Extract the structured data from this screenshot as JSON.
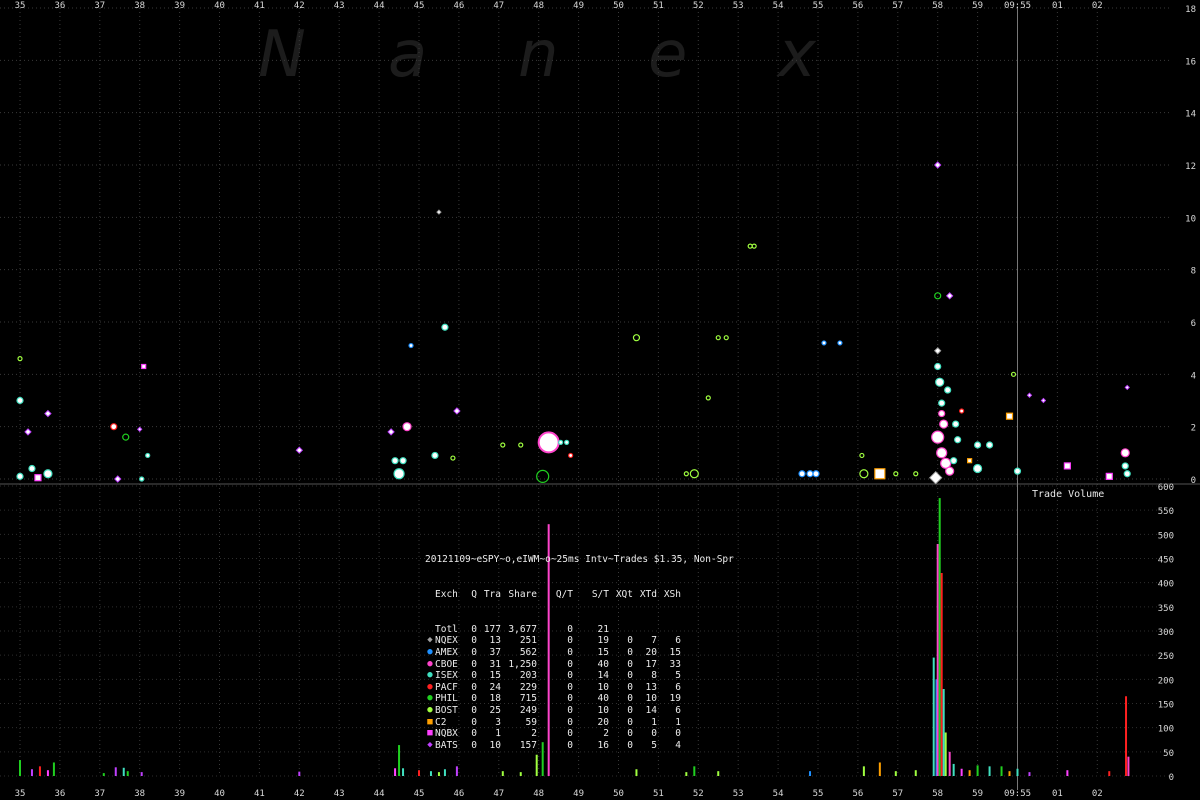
{
  "chart_data": {
    "type": "scatter",
    "watermark": [
      "N",
      "a",
      "n",
      "e",
      "x"
    ],
    "x_ticks": [
      "35",
      "36",
      "37",
      "38",
      "39",
      "40",
      "41",
      "42",
      "43",
      "44",
      "45",
      "46",
      "47",
      "48",
      "49",
      "50",
      "51",
      "52",
      "53",
      "54",
      "55",
      "56",
      "57",
      "58",
      "59",
      "09:55",
      "01",
      "02"
    ],
    "price_axis": {
      "ylim": [
        0,
        18
      ],
      "ticks": [
        "0",
        "2",
        "4",
        "6",
        "8",
        "10",
        "12",
        "14",
        "16",
        "18"
      ],
      "grid": true
    },
    "volume_axis": {
      "label": "Trade Volume",
      "ylim": [
        0,
        600
      ],
      "ticks": [
        "0",
        "50",
        "100",
        "150",
        "200",
        "250",
        "300",
        "350",
        "400",
        "450",
        "500",
        "550",
        "600"
      ]
    },
    "exchange_colors": {
      "NQEX": "#a0a0a0",
      "AMEX": "#1e90ff",
      "CBOE": "#ff44cc",
      "ISEX": "#40e0c0",
      "PACF": "#ff2020",
      "PHIL": "#20d020",
      "BOST": "#a0ff40",
      "C2": "#ffa000",
      "NQBX": "#ff40ff",
      "BATS": "#c040ff"
    },
    "trades": [
      {
        "x": 35.0,
        "y": 4.6,
        "ex": "BOST",
        "s": 2
      },
      {
        "x": 35.0,
        "y": 3.0,
        "ex": "ISEX",
        "s": 3
      },
      {
        "x": 35.2,
        "y": 1.8,
        "ex": "BATS",
        "s": 3
      },
      {
        "x": 35.0,
        "y": 0.1,
        "ex": "ISEX",
        "s": 3
      },
      {
        "x": 35.3,
        "y": 0.4,
        "ex": "ISEX",
        "s": 3
      },
      {
        "x": 35.45,
        "y": 0.05,
        "ex": "NQBX",
        "s": 3
      },
      {
        "x": 35.7,
        "y": 0.2,
        "ex": "ISEX",
        "s": 4
      },
      {
        "x": 35.7,
        "y": 2.5,
        "ex": "BATS",
        "s": 3
      },
      {
        "x": 37.35,
        "y": 2.0,
        "ex": "PACF",
        "s": 3
      },
      {
        "x": 37.65,
        "y": 1.6,
        "ex": "PHIL",
        "s": 3
      },
      {
        "x": 37.45,
        "y": 0.0,
        "ex": "BATS",
        "s": 3
      },
      {
        "x": 38.0,
        "y": 1.9,
        "ex": "BATS",
        "s": 2
      },
      {
        "x": 38.1,
        "y": 4.3,
        "ex": "NQBX",
        "s": 2
      },
      {
        "x": 38.2,
        "y": 0.9,
        "ex": "ISEX",
        "s": 2
      },
      {
        "x": 38.05,
        "y": 0.0,
        "ex": "ISEX",
        "s": 2
      },
      {
        "x": 42.0,
        "y": 1.1,
        "ex": "BATS",
        "s": 3
      },
      {
        "x": 44.3,
        "y": 1.8,
        "ex": "BATS",
        "s": 3
      },
      {
        "x": 44.5,
        "y": 0.2,
        "ex": "ISEX",
        "s": 5
      },
      {
        "x": 44.4,
        "y": 0.7,
        "ex": "ISEX",
        "s": 3
      },
      {
        "x": 44.6,
        "y": 0.7,
        "ex": "ISEX",
        "s": 3
      },
      {
        "x": 44.7,
        "y": 2.0,
        "ex": "CBOE",
        "s": 4
      },
      {
        "x": 44.8,
        "y": 5.1,
        "ex": "AMEX",
        "s": 2
      },
      {
        "x": 45.4,
        "y": 0.9,
        "ex": "ISEX",
        "s": 3
      },
      {
        "x": 45.5,
        "y": 10.2,
        "ex": "NQEX",
        "s": 2
      },
      {
        "x": 45.65,
        "y": 5.8,
        "ex": "ISEX",
        "s": 3
      },
      {
        "x": 45.85,
        "y": 0.8,
        "ex": "BOST",
        "s": 2
      },
      {
        "x": 45.95,
        "y": 2.6,
        "ex": "BATS",
        "s": 3
      },
      {
        "x": 47.1,
        "y": 1.3,
        "ex": "BOST",
        "s": 2
      },
      {
        "x": 47.55,
        "y": 1.3,
        "ex": "BOST",
        "s": 2
      },
      {
        "x": 48.25,
        "y": 1.4,
        "ex": "CBOE",
        "s": 10
      },
      {
        "x": 48.55,
        "y": 1.4,
        "ex": "ISEX",
        "s": 2
      },
      {
        "x": 48.7,
        "y": 1.4,
        "ex": "ISEX",
        "s": 2
      },
      {
        "x": 48.8,
        "y": 0.9,
        "ex": "PACF",
        "s": 2
      },
      {
        "x": 48.1,
        "y": 0.1,
        "ex": "PHIL",
        "s": 6
      },
      {
        "x": 50.45,
        "y": 5.4,
        "ex": "BOST",
        "s": 3
      },
      {
        "x": 51.7,
        "y": 0.2,
        "ex": "BOST",
        "s": 2
      },
      {
        "x": 51.9,
        "y": 0.2,
        "ex": "BOST",
        "s": 4
      },
      {
        "x": 52.25,
        "y": 3.1,
        "ex": "BOST",
        "s": 2
      },
      {
        "x": 52.5,
        "y": 5.4,
        "ex": "BOST",
        "s": 2
      },
      {
        "x": 52.7,
        "y": 5.4,
        "ex": "BOST",
        "s": 2
      },
      {
        "x": 53.3,
        "y": 8.9,
        "ex": "BOST",
        "s": 2
      },
      {
        "x": 53.4,
        "y": 8.9,
        "ex": "BOST",
        "s": 2
      },
      {
        "x": 54.6,
        "y": 0.2,
        "ex": "AMEX",
        "s": 3
      },
      {
        "x": 54.8,
        "y": 0.2,
        "ex": "AMEX",
        "s": 3
      },
      {
        "x": 54.95,
        "y": 0.2,
        "ex": "AMEX",
        "s": 3
      },
      {
        "x": 55.15,
        "y": 5.2,
        "ex": "AMEX",
        "s": 2
      },
      {
        "x": 55.55,
        "y": 5.2,
        "ex": "AMEX",
        "s": 2
      },
      {
        "x": 56.1,
        "y": 0.9,
        "ex": "BOST",
        "s": 2
      },
      {
        "x": 56.15,
        "y": 0.2,
        "ex": "BOST",
        "s": 4
      },
      {
        "x": 56.55,
        "y": 0.2,
        "ex": "C2",
        "s": 5
      },
      {
        "x": 56.95,
        "y": 0.2,
        "ex": "BOST",
        "s": 2
      },
      {
        "x": 57.45,
        "y": 0.2,
        "ex": "BOST",
        "s": 2
      },
      {
        "x": 58.0,
        "y": 12.0,
        "ex": "BATS",
        "s": 3
      },
      {
        "x": 58.0,
        "y": 7.0,
        "ex": "PHIL",
        "s": 3
      },
      {
        "x": 58.3,
        "y": 7.0,
        "ex": "BATS",
        "s": 3
      },
      {
        "x": 58.0,
        "y": 4.9,
        "ex": "NQEX",
        "s": 3
      },
      {
        "x": 58.0,
        "y": 4.3,
        "ex": "ISEX",
        "s": 3
      },
      {
        "x": 58.05,
        "y": 3.7,
        "ex": "ISEX",
        "s": 4
      },
      {
        "x": 58.1,
        "y": 2.9,
        "ex": "ISEX",
        "s": 3
      },
      {
        "x": 58.1,
        "y": 2.5,
        "ex": "CBOE",
        "s": 3
      },
      {
        "x": 58.15,
        "y": 2.1,
        "ex": "CBOE",
        "s": 4
      },
      {
        "x": 58.0,
        "y": 1.6,
        "ex": "CBOE",
        "s": 6
      },
      {
        "x": 58.1,
        "y": 1.0,
        "ex": "CBOE",
        "s": 5
      },
      {
        "x": 58.2,
        "y": 0.6,
        "ex": "CBOE",
        "s": 5
      },
      {
        "x": 58.3,
        "y": 0.3,
        "ex": "CBOE",
        "s": 4
      },
      {
        "x": 57.95,
        "y": 0.05,
        "ex": "NQEX",
        "s": 6
      },
      {
        "x": 58.25,
        "y": 3.4,
        "ex": "ISEX",
        "s": 3
      },
      {
        "x": 58.45,
        "y": 2.1,
        "ex": "ISEX",
        "s": 3
      },
      {
        "x": 58.6,
        "y": 2.6,
        "ex": "PACF",
        "s": 2
      },
      {
        "x": 58.5,
        "y": 1.5,
        "ex": "ISEX",
        "s": 3
      },
      {
        "x": 58.4,
        "y": 0.7,
        "ex": "ISEX",
        "s": 3
      },
      {
        "x": 58.8,
        "y": 0.7,
        "ex": "C2",
        "s": 2
      },
      {
        "x": 59.0,
        "y": 1.3,
        "ex": "ISEX",
        "s": 3
      },
      {
        "x": 59.3,
        "y": 1.3,
        "ex": "ISEX",
        "s": 3
      },
      {
        "x": 59.0,
        "y": 0.4,
        "ex": "ISEX",
        "s": 4
      },
      {
        "x": 59.8,
        "y": 2.4,
        "ex": "C2",
        "s": 3
      },
      {
        "x": 59.9,
        "y": 4.0,
        "ex": "BOST",
        "s": 2
      },
      {
        "x": 60.0,
        "y": 0.3,
        "ex": "ISEX",
        "s": 3
      },
      {
        "x": 60.3,
        "y": 3.2,
        "ex": "BATS",
        "s": 2
      },
      {
        "x": 60.65,
        "y": 3.0,
        "ex": "BATS",
        "s": 2
      },
      {
        "x": 61.25,
        "y": 0.5,
        "ex": "NQBX",
        "s": 3
      },
      {
        "x": 62.3,
        "y": 0.1,
        "ex": "NQBX",
        "s": 3
      },
      {
        "x": 62.7,
        "y": 1.0,
        "ex": "CBOE",
        "s": 4
      },
      {
        "x": 62.7,
        "y": 0.5,
        "ex": "ISEX",
        "s": 3
      },
      {
        "x": 62.75,
        "y": 0.2,
        "ex": "ISEX",
        "s": 3
      },
      {
        "x": 62.75,
        "y": 3.5,
        "ex": "BATS",
        "s": 2
      }
    ],
    "volume_bars": [
      {
        "x": 35.0,
        "v": 33,
        "ex": "PHIL"
      },
      {
        "x": 35.3,
        "v": 14,
        "ex": "BATS"
      },
      {
        "x": 35.5,
        "v": 20,
        "ex": "PACF"
      },
      {
        "x": 35.7,
        "v": 12,
        "ex": "NQBX"
      },
      {
        "x": 35.85,
        "v": 28,
        "ex": "PHIL"
      },
      {
        "x": 37.1,
        "v": 6,
        "ex": "PHIL"
      },
      {
        "x": 37.4,
        "v": 18,
        "ex": "BATS"
      },
      {
        "x": 37.6,
        "v": 17,
        "ex": "ISEX"
      },
      {
        "x": 37.7,
        "v": 10,
        "ex": "PHIL"
      },
      {
        "x": 38.05,
        "v": 8,
        "ex": "BATS"
      },
      {
        "x": 42.0,
        "v": 9,
        "ex": "BATS"
      },
      {
        "x": 44.4,
        "v": 16,
        "ex": "NQBX"
      },
      {
        "x": 44.5,
        "v": 64,
        "ex": "PHIL"
      },
      {
        "x": 44.6,
        "v": 16,
        "ex": "ISEX"
      },
      {
        "x": 45.0,
        "v": 12,
        "ex": "PACF"
      },
      {
        "x": 45.3,
        "v": 10,
        "ex": "ISEX"
      },
      {
        "x": 45.5,
        "v": 8,
        "ex": "BOST"
      },
      {
        "x": 45.65,
        "v": 14,
        "ex": "ISEX"
      },
      {
        "x": 45.95,
        "v": 20,
        "ex": "BATS"
      },
      {
        "x": 47.1,
        "v": 10,
        "ex": "BOST"
      },
      {
        "x": 47.55,
        "v": 8,
        "ex": "BOST"
      },
      {
        "x": 47.95,
        "v": 44,
        "ex": "BOST"
      },
      {
        "x": 48.1,
        "v": 70,
        "ex": "PHIL"
      },
      {
        "x": 48.25,
        "v": 521,
        "ex": "CBOE"
      },
      {
        "x": 50.45,
        "v": 14,
        "ex": "BOST"
      },
      {
        "x": 51.7,
        "v": 8,
        "ex": "BOST"
      },
      {
        "x": 51.9,
        "v": 20,
        "ex": "PHIL"
      },
      {
        "x": 52.5,
        "v": 10,
        "ex": "BOST"
      },
      {
        "x": 54.8,
        "v": 10,
        "ex": "AMEX"
      },
      {
        "x": 56.15,
        "v": 20,
        "ex": "BOST"
      },
      {
        "x": 56.55,
        "v": 28,
        "ex": "C2"
      },
      {
        "x": 56.95,
        "v": 10,
        "ex": "BOST"
      },
      {
        "x": 57.45,
        "v": 12,
        "ex": "BOST"
      },
      {
        "x": 57.9,
        "v": 245,
        "ex": "ISEX"
      },
      {
        "x": 57.97,
        "v": 200,
        "ex": "AMEX"
      },
      {
        "x": 58.0,
        "v": 480,
        "ex": "CBOE"
      },
      {
        "x": 58.05,
        "v": 575,
        "ex": "PHIL"
      },
      {
        "x": 58.1,
        "v": 420,
        "ex": "PACF"
      },
      {
        "x": 58.15,
        "v": 180,
        "ex": "ISEX"
      },
      {
        "x": 58.2,
        "v": 90,
        "ex": "BOST"
      },
      {
        "x": 58.3,
        "v": 50,
        "ex": "CBOE"
      },
      {
        "x": 58.4,
        "v": 25,
        "ex": "ISEX"
      },
      {
        "x": 58.6,
        "v": 15,
        "ex": "NQBX"
      },
      {
        "x": 58.8,
        "v": 12,
        "ex": "C2"
      },
      {
        "x": 59.0,
        "v": 22,
        "ex": "PHIL"
      },
      {
        "x": 59.3,
        "v": 20,
        "ex": "ISEX"
      },
      {
        "x": 59.6,
        "v": 20,
        "ex": "PHIL"
      },
      {
        "x": 59.8,
        "v": 10,
        "ex": "C2"
      },
      {
        "x": 60.0,
        "v": 15,
        "ex": "ISEX"
      },
      {
        "x": 60.3,
        "v": 8,
        "ex": "BATS"
      },
      {
        "x": 61.25,
        "v": 12,
        "ex": "NQBX"
      },
      {
        "x": 62.3,
        "v": 10,
        "ex": "PACF"
      },
      {
        "x": 62.72,
        "v": 165,
        "ex": "PACF"
      },
      {
        "x": 62.78,
        "v": 40,
        "ex": "CBOE"
      }
    ]
  },
  "summary": {
    "title": "20121109~eSPY~o,eIWM~o~25ms Intv~Trades $1.35, Non-Spr",
    "header": [
      "Exch",
      "Q",
      "Tra",
      "Share",
      "Q/T",
      "S/T",
      "XQt",
      "XTd",
      "XSh"
    ],
    "rows": [
      {
        "mark": "",
        "ex": "Totl",
        "cells": [
          "0",
          "177",
          "3,677",
          "0",
          "21",
          "",
          "",
          ""
        ]
      },
      {
        "mark": "◆",
        "ex": "NQEX",
        "cells": [
          "0",
          "13",
          "251",
          "0",
          "19",
          "0",
          "7",
          "6"
        ]
      },
      {
        "mark": "●",
        "ex": "AMEX",
        "cells": [
          "0",
          "37",
          "562",
          "0",
          "15",
          "0",
          "20",
          "15"
        ]
      },
      {
        "mark": "●",
        "ex": "CBOE",
        "cells": [
          "0",
          "31",
          "1,250",
          "0",
          "40",
          "0",
          "17",
          "33"
        ]
      },
      {
        "mark": "●",
        "ex": "ISEX",
        "cells": [
          "0",
          "15",
          "203",
          "0",
          "14",
          "0",
          "8",
          "5"
        ]
      },
      {
        "mark": "●",
        "ex": "PACF",
        "cells": [
          "0",
          "24",
          "229",
          "0",
          "10",
          "0",
          "13",
          "6"
        ]
      },
      {
        "mark": "●",
        "ex": "PHIL",
        "cells": [
          "0",
          "18",
          "715",
          "0",
          "40",
          "0",
          "10",
          "19"
        ]
      },
      {
        "mark": "●",
        "ex": "BOST",
        "cells": [
          "0",
          "25",
          "249",
          "0",
          "10",
          "0",
          "14",
          "6"
        ]
      },
      {
        "mark": "■",
        "ex": "C2",
        "cells": [
          "0",
          "3",
          "59",
          "0",
          "20",
          "0",
          "1",
          "1"
        ]
      },
      {
        "mark": "■",
        "ex": "NQBX",
        "cells": [
          "0",
          "1",
          "2",
          "0",
          "2",
          "0",
          "0",
          "0"
        ]
      },
      {
        "mark": "◆",
        "ex": "BATS",
        "cells": [
          "0",
          "10",
          "157",
          "0",
          "16",
          "0",
          "5",
          "4"
        ]
      }
    ]
  }
}
